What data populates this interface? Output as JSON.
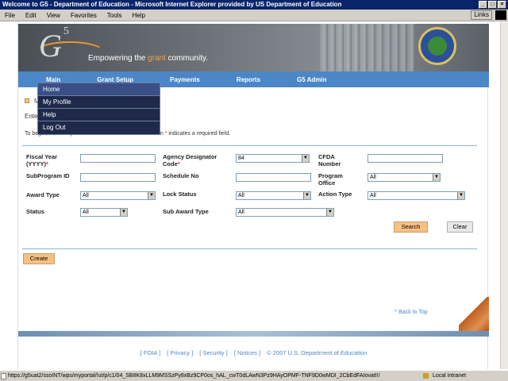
{
  "browser": {
    "title": "Welcome to G5 - Department of Education - Microsoft Internet Explorer provided by US Department of Education",
    "menu": [
      "File",
      "Edit",
      "View",
      "Favorites",
      "Tools",
      "Help"
    ],
    "links_label": "Links",
    "status_url": "https://g5uat2/ssoINT/wps/myportal/!ut/p/c1/04_SB8K8xLLM9MSSzPy8xBz9CP0os_hAL_cwT0dLAwN3Pz9HAyOPMF-TNF9D0wMDI_2CbEdFAIovatI!/",
    "status_zone": "Local intranet"
  },
  "banner": {
    "logo_text": "G",
    "logo_sup": "5",
    "tagline_pre": "Empowering the ",
    "tagline_grant": "grant",
    "tagline_post": " community."
  },
  "nav": {
    "items": [
      "Main",
      "Grant Setup",
      "Payments",
      "Reports",
      "G5 Admin"
    ]
  },
  "dropdown": {
    "items": [
      "Home",
      "My Profile",
      "Help",
      "Log Out"
    ]
  },
  "page": {
    "breadcrumb": "M",
    "enter_text": "Ente",
    "instructions_pre": "To begin, search by one or more of the criteria below. An ",
    "instructions_star": "*",
    "instructions_post": " indicates a required field."
  },
  "form": {
    "fiscal_year_label": "Fiscal Year (YYYY)",
    "fiscal_year_value": "",
    "agency_label": "Agency Designator Code",
    "agency_value": "84",
    "cfda_label": "CFDA Number",
    "cfda_value": "",
    "subprogram_label": "SubProgram ID",
    "subprogram_value": "",
    "schedule_label": "Schedule No",
    "schedule_value": "",
    "program_office_label": "Program Office",
    "program_office_value": "All",
    "award_type_label": "Award Type",
    "award_type_value": "All",
    "lock_status_label": "Lock Status",
    "lock_status_value": "All",
    "action_type_label": "Action Type",
    "action_type_value": "All",
    "status_label": "Status",
    "status_value": "All",
    "sub_award_type_label": "Sub Award Type",
    "sub_award_type_value": "All",
    "required_star": "*",
    "search_button": "Search",
    "clear_button": "Clear",
    "create_button": "Create"
  },
  "footer": {
    "back_to_top": "^ Back to Top",
    "links": [
      "[ FOIA ]",
      "[ Privacy ]",
      "[ Security ]",
      "[ Notices ]"
    ],
    "copyright": "© 2007 U.S. Department of Education"
  }
}
